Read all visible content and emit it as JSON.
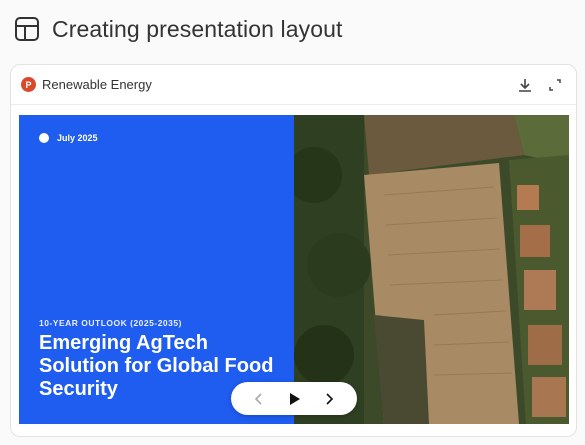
{
  "header": {
    "title": "Creating presentation layout",
    "icon": "layout-icon"
  },
  "card": {
    "file_name": "Renewable Energy",
    "file_icon": "powerpoint-icon",
    "file_icon_letter": "P",
    "actions": [
      "download-icon",
      "expand-icon"
    ]
  },
  "slide": {
    "date": "July 2025",
    "kicker": "10-YEAR OUTLOOK (2025-2035)",
    "headline": "Emerging AgTech Solution for Global Food Security",
    "accent_color": "#1f5cf0",
    "image": "aerial-farmland-photo"
  },
  "player": {
    "controls": [
      "previous-icon",
      "play-icon",
      "next-icon"
    ]
  }
}
